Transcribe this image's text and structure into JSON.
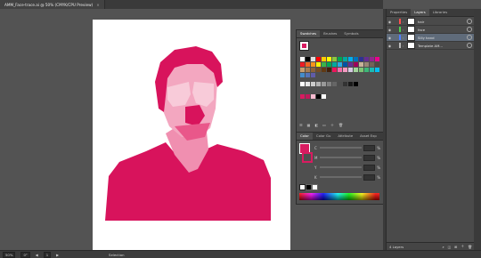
{
  "document": {
    "tab_title": "AMM_Face-trace.ai @ 50% (CMYK/CPU Preview)",
    "close_glyph": "×"
  },
  "status": {
    "zoom": "50%",
    "rotation": "0°",
    "artboard": "1",
    "tool": "Selection"
  },
  "swatches_panel": {
    "tabs": [
      "Swatches",
      "Brushes",
      "Symbols"
    ],
    "swatch_colors": [
      "#ffffff",
      "#000000",
      "#e0e0e0",
      "#ff0000",
      "#ffcc00",
      "#ffff00",
      "#8cc63f",
      "#00a651",
      "#00a99d",
      "#00aeef",
      "#0072bc",
      "#2e3192",
      "#662d91",
      "#92278f",
      "#ec008c",
      "#ed1c24",
      "#f26522",
      "#f7941d",
      "#fff200",
      "#39b54a",
      "#00a651",
      "#00a99d",
      "#29abe2",
      "#0054a6",
      "#662d91",
      "#9e005d",
      "#c7b299",
      "#998675",
      "#736357",
      "#534741",
      "#c69c6d",
      "#a67c52",
      "#8c6239",
      "#754c24",
      "#603913",
      "#42210b",
      "#ed145b",
      "#f06eaa",
      "#f49ac1",
      "#d7c9e3",
      "#a3d39c",
      "#7cc576",
      "#3cb878",
      "#1cbbb4",
      "#00bff3",
      "#448ccb",
      "#5574b9",
      "#605ca8"
    ],
    "gray_colors": [
      "#ffffff",
      "#e6e6e6",
      "#cccccc",
      "#b3b3b3",
      "#999999",
      "#808080",
      "#666666",
      "#4d4d4d",
      "#333333",
      "#1a1a1a",
      "#000000"
    ],
    "group_colors": [
      "#d81b60",
      "#c2185b",
      "#f8bbd0",
      "#000000",
      "#ffffff"
    ]
  },
  "color_panel": {
    "tabs": [
      "Color",
      "Color Gu",
      "Attribute",
      "Asset Exp"
    ],
    "sliders": [
      {
        "label": "C",
        "unit": "%"
      },
      {
        "label": "M",
        "unit": "%"
      },
      {
        "label": "Y",
        "unit": "%"
      },
      {
        "label": "K",
        "unit": "%"
      }
    ]
  },
  "layers_panel": {
    "tabs": [
      "Properties",
      "Layers",
      "Libraries"
    ],
    "layers": [
      {
        "name": "hair",
        "color": "#ff4f4f",
        "selected": false
      },
      {
        "name": "face",
        "color": "#4fd14f",
        "selected": false
      },
      {
        "name": "Silly hand",
        "color": "#4f7fff",
        "selected": true
      },
      {
        "name": "Template AM...",
        "color": "#bbbbbb",
        "selected": false
      }
    ],
    "footer_label": "4 Layers"
  },
  "accent": "#d81b60",
  "icons": [
    "close-icon",
    "eye-icon",
    "lock-icon",
    "expand-arrow-icon",
    "target-icon",
    "new-layer-icon",
    "delete-icon"
  ]
}
